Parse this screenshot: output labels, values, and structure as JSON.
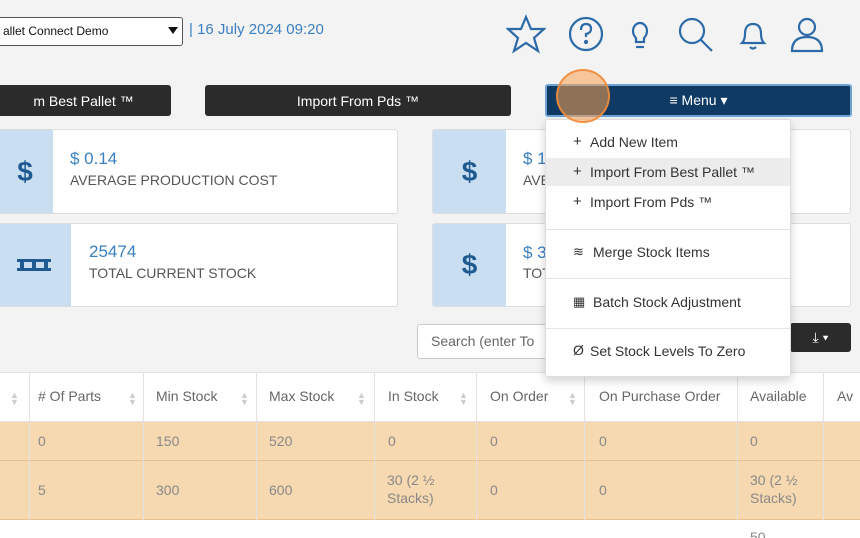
{
  "header": {
    "company_select_value": "allet Connect Demo",
    "datetime": "| 16 July 2024 09:20",
    "icons": [
      "star-icon",
      "help-icon",
      "lightbulb-icon",
      "search-icon",
      "bell-icon",
      "user-icon"
    ]
  },
  "buttons": {
    "import_best_pallet": "m Best Pallet ™",
    "import_pds": "Import From Pds ™",
    "menu": "≡ Menu ▾"
  },
  "cards": [
    {
      "value": "$ 0.14",
      "label": "AVERAGE PRODUCTION COST",
      "icon": "$"
    },
    {
      "value": "25474",
      "label": "TOTAL CURRENT STOCK",
      "icon": "pallet"
    },
    {
      "value": "$ 1",
      "label": "AVE",
      "icon": "$"
    },
    {
      "value": "$ 3",
      "label": "TOT",
      "icon": "$"
    }
  ],
  "search": {
    "placeholder": "Search (enter To"
  },
  "export": {
    "label": "⤓ ▾"
  },
  "menu_items": [
    {
      "icon": "+",
      "label": "Add New Item"
    },
    {
      "icon": "+",
      "label": "Import From Best Pallet ™"
    },
    {
      "icon": "+",
      "label": "Import From Pds ™"
    },
    {
      "icon": "≋",
      "label": "Merge Stock Items"
    },
    {
      "icon": "▦",
      "label": "Batch Stock Adjustment"
    },
    {
      "icon": "Ø",
      "label": "Set Stock Levels To Zero"
    }
  ],
  "table": {
    "headers": [
      "# Of Parts",
      "Min Stock",
      "Max Stock",
      "In Stock",
      "On Order",
      "On Purchase Order",
      "Available",
      "Av"
    ],
    "rows": [
      [
        "0",
        "150",
        "520",
        "0",
        "0",
        "0",
        "0"
      ],
      [
        "5",
        "300",
        "600",
        "30 (2 ½",
        "0",
        "0",
        "30 (2 ½"
      ],
      [
        "",
        "",
        "",
        "",
        "",
        "",
        "50"
      ]
    ],
    "row2_line2": [
      "Stacks)",
      "Stacks)"
    ]
  },
  "colors": {
    "accent": "#2c6aa8",
    "menu_bg": "#0f3a63",
    "row_highlight": "#f7d9b1"
  }
}
